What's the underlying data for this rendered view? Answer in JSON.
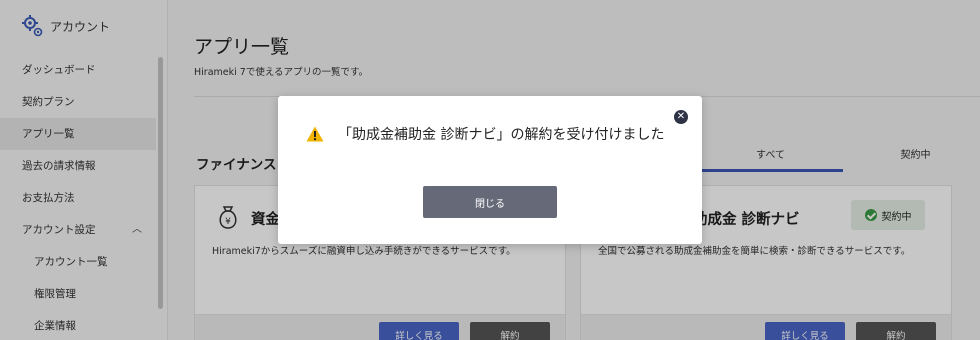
{
  "sidebar": {
    "brand_label": "アカウント",
    "items": [
      {
        "label": "ダッシュボード"
      },
      {
        "label": "契約プラン"
      },
      {
        "label": "アプリ一覧"
      },
      {
        "label": "過去の請求情報"
      },
      {
        "label": "お支払方法"
      },
      {
        "label": "アカウント設定"
      },
      {
        "label": "アカウント一覧"
      },
      {
        "label": "権限管理"
      },
      {
        "label": "企業情報"
      }
    ]
  },
  "main": {
    "title": "アプリ一覧",
    "subtitle": "Hirameki 7で使えるアプリの一覧です。",
    "section_title": "ファイナンス",
    "tabs": [
      {
        "label": "すべて"
      },
      {
        "label": "契約中"
      }
    ],
    "cards": [
      {
        "title": "資金",
        "description": "Hirameki7からスムーズに融資申し込み手続きができるサービスです。",
        "detail_label": "詳しく見る",
        "cancel_label": "解約"
      },
      {
        "title": "助成金 診断ナビ",
        "badge": "契約中",
        "description": "全国で公募される助成金補助金を簡単に検索・診断できるサービスです。",
        "detail_label": "詳しく見る",
        "cancel_label": "解約"
      }
    ]
  },
  "modal": {
    "message": "「助成金補助金 診断ナビ」の解約を受け付けました",
    "close_label": "閉じる"
  },
  "colors": {
    "accent": "#3c55b5",
    "success": "#3a9b45",
    "warning": "#f0b400"
  }
}
